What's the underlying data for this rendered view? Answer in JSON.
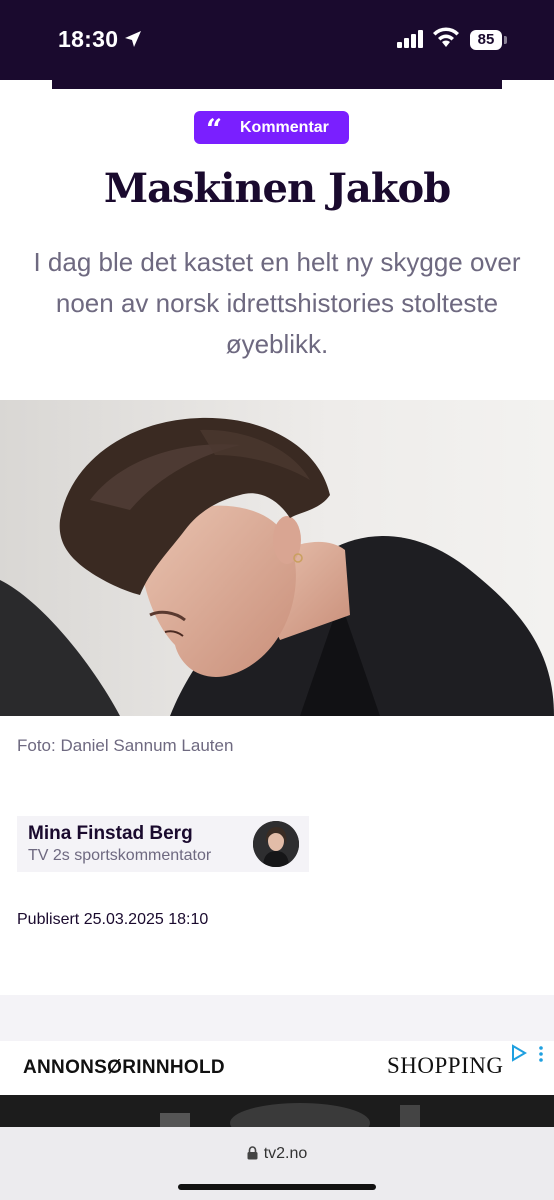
{
  "status_bar": {
    "time": "18:30",
    "battery": "85",
    "icons": [
      "location-arrow-icon",
      "cellular-signal-icon",
      "wifi-icon",
      "battery-icon"
    ]
  },
  "article": {
    "category": "Kommentar",
    "category_icon": "quote-icon",
    "headline": "Maskinen Jakob",
    "lead": "I dag ble det kastet en helt ny skygge over noen av norsk idrettshistories stolteste øyeblikk.",
    "photo_credit": "Foto: Daniel Sannum Lauten",
    "author": {
      "name": "Mina Finstad Berg",
      "role": "TV 2s sportskommentator"
    },
    "published": "Publisert 25.03.2025 18:10"
  },
  "ad": {
    "label": "ANNONSØRINNHOLD",
    "brand": "SHOPPING",
    "icons": [
      "adchoices-icon",
      "more-vertical-icon"
    ]
  },
  "browser": {
    "url": "tv2.no"
  },
  "colors": {
    "brand_dark": "#1a0a2e",
    "accent_purple": "#7a1fff",
    "muted_text": "#6e6980",
    "panel_bg": "#f4f3f7"
  }
}
